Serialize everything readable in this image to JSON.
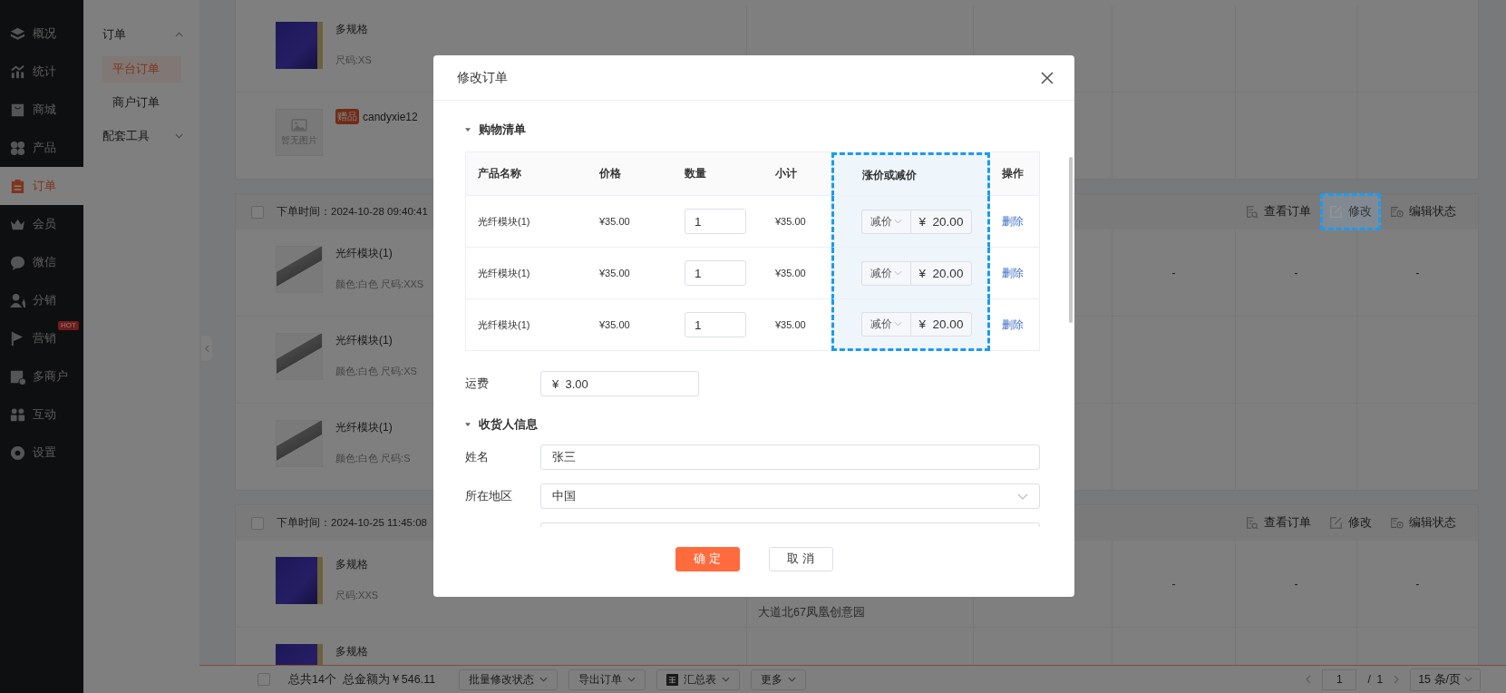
{
  "nav": {
    "items": [
      {
        "label": "概况",
        "selected": false
      },
      {
        "label": "统计",
        "selected": false
      },
      {
        "label": "商城",
        "selected": false
      },
      {
        "label": "产品",
        "selected": false
      },
      {
        "label": "订单",
        "selected": true
      },
      {
        "label": "会员",
        "selected": false
      },
      {
        "label": "微信",
        "selected": false
      },
      {
        "label": "分销",
        "selected": false
      },
      {
        "label": "营销",
        "selected": false,
        "badge": "HOT"
      },
      {
        "label": "多商户",
        "selected": false
      },
      {
        "label": "互动",
        "selected": false
      },
      {
        "label": "设置",
        "selected": false
      }
    ]
  },
  "subnav": {
    "groups": [
      {
        "label": "订单",
        "expanded": true,
        "children": [
          {
            "label": "平台订单",
            "selected": true
          },
          {
            "label": "商户订单",
            "selected": false
          }
        ]
      },
      {
        "label": "配套工具",
        "expanded": false
      }
    ]
  },
  "orders": [
    {
      "items": [
        {
          "kind": "banner",
          "name": "多规格",
          "spec": "尺码:XS"
        },
        {
          "kind": "none",
          "image_text": "暂无图片",
          "tag": "赠品",
          "name": "candyxie12"
        }
      ]
    },
    {
      "checked": false,
      "placed_at": "下单时间：2024-10-28 09:40:41",
      "actions": [
        {
          "label": "查看订单",
          "highlighted": false
        },
        {
          "label": "修改",
          "highlighted": true
        },
        {
          "label": "编辑状态",
          "highlighted": false
        }
      ],
      "items": [
        {
          "kind": "module",
          "name": "光纤模块(1)",
          "spec": "颜色:白色 尺码:XXS",
          "cells": [
            "-",
            "-",
            "-"
          ]
        },
        {
          "kind": "module",
          "name": "光纤模块(1)",
          "spec": "颜色:白色 尺码:XS"
        },
        {
          "kind": "module",
          "name": "光纤模块(1)",
          "spec": "颜色:白色 尺码:S"
        }
      ]
    },
    {
      "checked": false,
      "placed_at": "下单时间：2024-10-25 11:45:08",
      "actions": [
        {
          "label": "查看订单",
          "highlighted": false
        },
        {
          "label": "修改",
          "highlighted": false
        },
        {
          "label": "编辑状态",
          "highlighted": false
        }
      ],
      "items": [
        {
          "kind": "banner",
          "name": "多规格",
          "spec": "尺码:XXS",
          "address": "大道北67凤凰创意园",
          "cells": [
            "-",
            "-",
            "-"
          ]
        },
        {
          "kind": "banner",
          "name": "多规格"
        }
      ]
    }
  ],
  "footer": {
    "checked": false,
    "summary": "总共14个  总金额为￥546.11",
    "actions": [
      {
        "label": "批量修改状态"
      },
      {
        "label": "导出订单"
      },
      {
        "label": "汇总表"
      },
      {
        "label": "更多"
      }
    ],
    "page": "1",
    "total_pages": "/  1",
    "page_size": "15 条/页"
  },
  "dialog": {
    "title": "修改订单",
    "cart": {
      "title": "购物清单",
      "expanded": true,
      "columns": [
        {
          "label": "产品名称",
          "highlighted": false
        },
        {
          "label": "价格",
          "highlighted": false
        },
        {
          "label": "数量",
          "highlighted": false
        },
        {
          "label": "小计",
          "highlighted": false
        },
        {
          "label": "涨价或减价",
          "highlighted": true
        },
        {
          "label": "操作",
          "highlighted": false
        }
      ],
      "rows": [
        {
          "name": "光纤模块(1)",
          "price": "¥35.00",
          "quantity": "1",
          "subtotal": "¥35.00",
          "adjust_type": "减价",
          "adjust_prefix": "¥",
          "adjust_amount": "20.00",
          "action": "删除"
        },
        {
          "name": "光纤模块(1)",
          "price": "¥35.00",
          "quantity": "1",
          "subtotal": "¥35.00",
          "adjust_type": "减价",
          "adjust_prefix": "¥",
          "adjust_amount": "20.00",
          "action": "删除"
        },
        {
          "name": "光纤模块(1)",
          "price": "¥35.00",
          "quantity": "1",
          "subtotal": "¥35.00",
          "adjust_type": "减价",
          "adjust_prefix": "¥",
          "adjust_amount": "20.00",
          "action": "删除"
        }
      ]
    },
    "shipping": {
      "label": "运费",
      "prefix": "¥",
      "value": "3.00"
    },
    "receiver": {
      "title": "收货人信息",
      "expanded": true,
      "fields": [
        {
          "kind": "text",
          "label": "姓名",
          "value": "张三"
        },
        {
          "kind": "select",
          "label": "所在地区",
          "value": "中国"
        },
        {
          "kind": "text"
        }
      ]
    },
    "buttons": [
      {
        "label": "确 定",
        "kind": "primary"
      },
      {
        "label": "取 消",
        "kind": "default"
      }
    ]
  }
}
